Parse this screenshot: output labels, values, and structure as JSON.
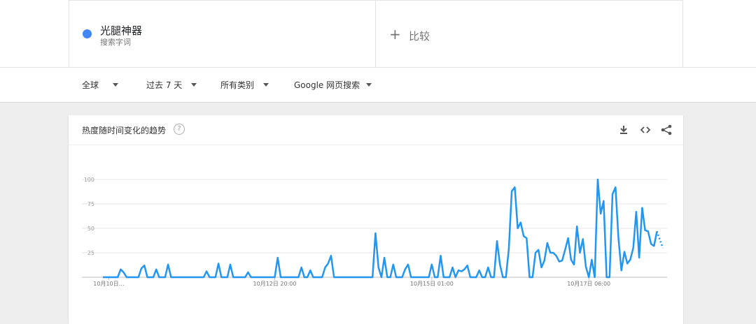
{
  "term": {
    "name": "光腿神器",
    "type": "搜索字词",
    "color": "#4285f4"
  },
  "compare": {
    "plus": "+",
    "label": "比较"
  },
  "filters": [
    {
      "label": "全球"
    },
    {
      "label": "过去 7 天"
    },
    {
      "label": "所有类别"
    },
    {
      "label": "Google 网页搜索"
    }
  ],
  "card": {
    "title": "热度随时间变化的趋势",
    "help": "?",
    "icons": [
      "download-icon",
      "embed-icon",
      "share-icon"
    ]
  },
  "chart_data": {
    "type": "line",
    "ylim": [
      0,
      100
    ],
    "yticks": [
      100,
      75,
      50,
      25
    ],
    "xtick_labels": [
      "10月10日…",
      "10月12日 20:00",
      "10月15日 01:00",
      "10月17日 06:00"
    ],
    "xtick_index": [
      2,
      58,
      111,
      164
    ],
    "grid": true,
    "line_color": "#2196f3",
    "series": [
      {
        "values": [
          0,
          0,
          0,
          0,
          0,
          0,
          8,
          5,
          0,
          0,
          0,
          0,
          0,
          9,
          12,
          0,
          0,
          0,
          8,
          0,
          0,
          0,
          13,
          0,
          0,
          0,
          0,
          0,
          0,
          0,
          0,
          0,
          0,
          0,
          0,
          6,
          0,
          0,
          0,
          14,
          0,
          0,
          0,
          13,
          0,
          0,
          0,
          0,
          0,
          5,
          0,
          0,
          0,
          0,
          0,
          0,
          0,
          0,
          0,
          20,
          0,
          0,
          0,
          0,
          0,
          0,
          0,
          10,
          0,
          0,
          7,
          0,
          0,
          0,
          0,
          10,
          14,
          22,
          0,
          0,
          0,
          0,
          0,
          0,
          0,
          0,
          0,
          0,
          0,
          0,
          0,
          0,
          45,
          10,
          0,
          20,
          0,
          0,
          13,
          0,
          0,
          0,
          8,
          13,
          0,
          0,
          0,
          0,
          0,
          0,
          0,
          13,
          0,
          0,
          22,
          0,
          0,
          0,
          10,
          0,
          7,
          6,
          8,
          12,
          0,
          0,
          0,
          7,
          0,
          0,
          10,
          0,
          0,
          37,
          13,
          0,
          0,
          29,
          88,
          92,
          50,
          56,
          42,
          40,
          0,
          0,
          25,
          28,
          10,
          17,
          35,
          25,
          25,
          22,
          16,
          17,
          28,
          40,
          18,
          13,
          52,
          25,
          39,
          11,
          0,
          18,
          0,
          100,
          65,
          78,
          0,
          0,
          85,
          92,
          40,
          7,
          26,
          14,
          18,
          30,
          67,
          20,
          71,
          48,
          47,
          34,
          32,
          47
        ],
        "partial_tail": [
          47,
          38,
          30
        ]
      }
    ]
  }
}
